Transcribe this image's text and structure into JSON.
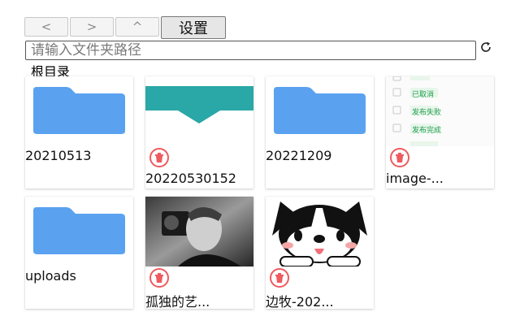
{
  "toolbar": {
    "back_label": "<",
    "forward_label": ">",
    "up_label": "^",
    "settings_label": "设置"
  },
  "path_input": {
    "placeholder": "请输入文件夹路径",
    "value": ""
  },
  "root_label": "根目录",
  "items": [
    {
      "type": "folder",
      "name": "20210513"
    },
    {
      "type": "file",
      "name": "20220530152"
    },
    {
      "type": "folder",
      "name": "20221209"
    },
    {
      "type": "file",
      "name": "image-...",
      "list_rows": [
        "已取消",
        "发布失败",
        "发布完成"
      ]
    },
    {
      "type": "folder",
      "name": "uploads"
    },
    {
      "type": "file",
      "name": "孤独的艺..."
    },
    {
      "type": "file",
      "name": "边牧-202..."
    }
  ],
  "colors": {
    "folder": "#5aa2f0",
    "delete": "#ef5a5f",
    "teal": "#2aa7a7",
    "tag_green": "#1e9e4a"
  },
  "icons": {
    "refresh": "refresh-icon",
    "delete": "trash-icon",
    "folder": "folder-icon"
  }
}
